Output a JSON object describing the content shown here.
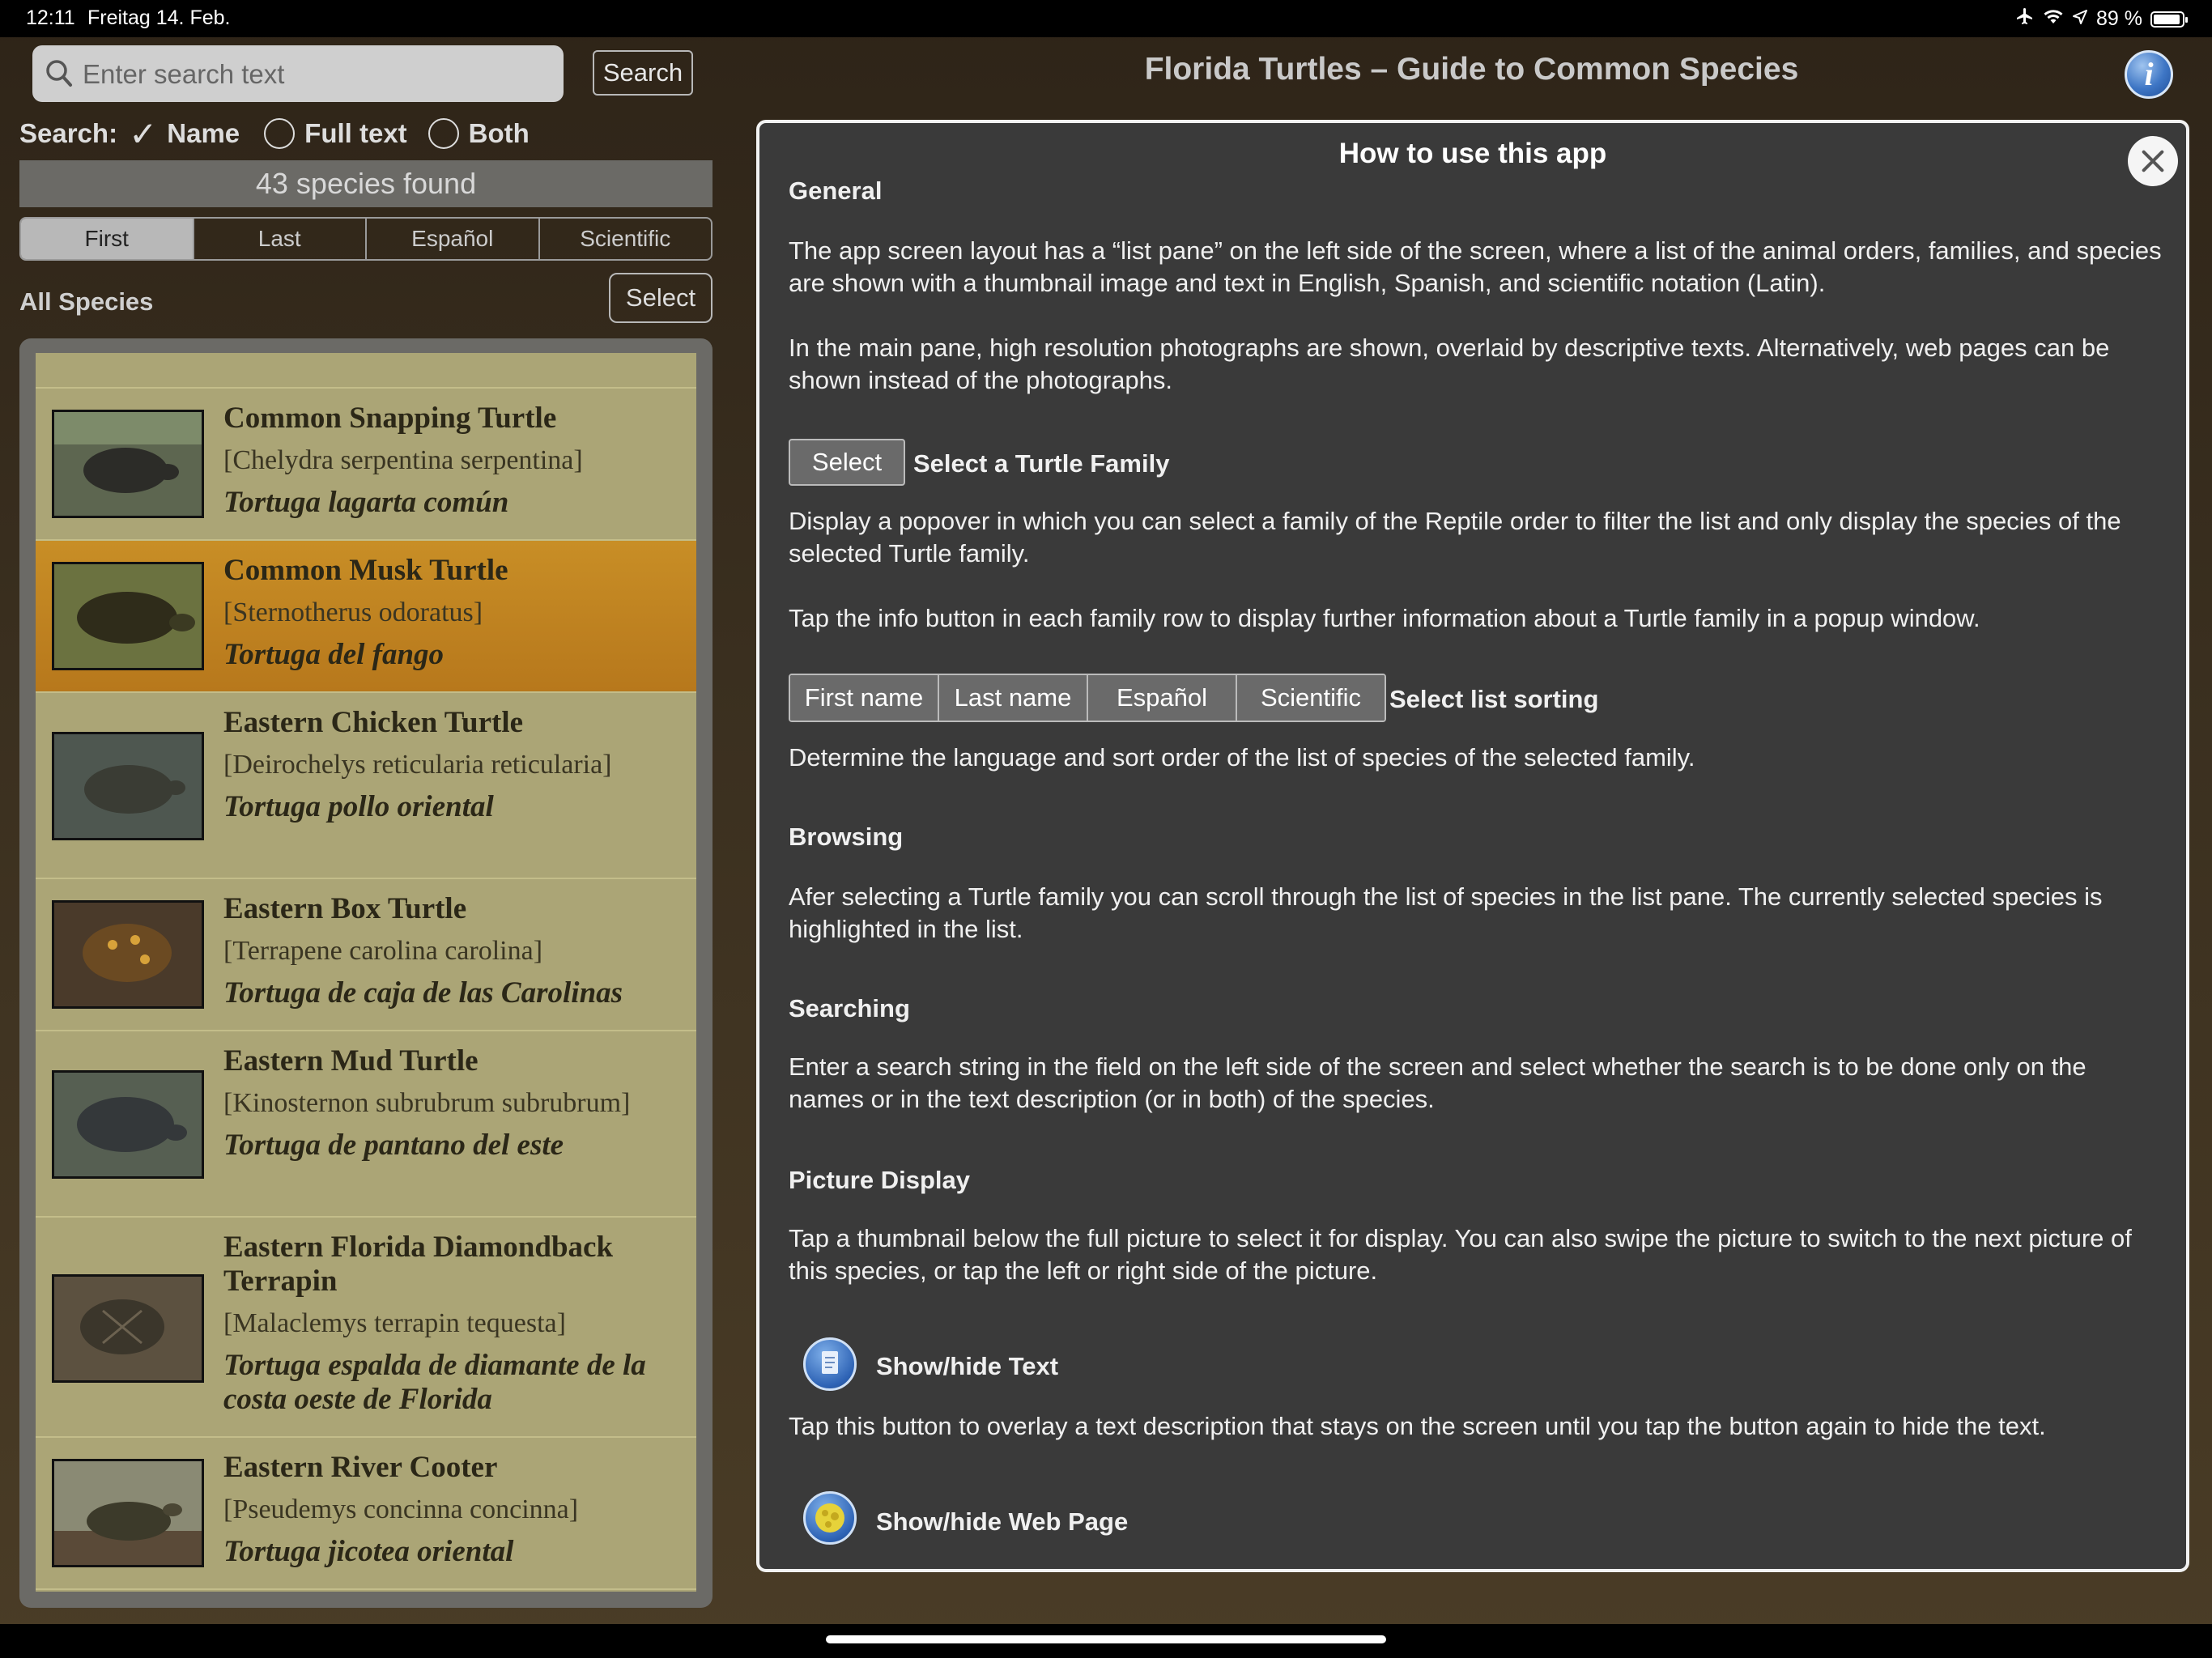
{
  "status_bar": {
    "time": "12:11",
    "date": "Freitag 14. Feb.",
    "battery": "89 %"
  },
  "search": {
    "placeholder": "Enter search text",
    "button_label": "Search",
    "options_label": "Search:",
    "options": [
      {
        "label": "Name",
        "selected": true
      },
      {
        "label": "Full text",
        "selected": false
      },
      {
        "label": "Both",
        "selected": false
      }
    ]
  },
  "result_count": "43 species found",
  "sort_tabs": [
    {
      "label": "First",
      "active": true
    },
    {
      "label": "Last",
      "active": false
    },
    {
      "label": "Español",
      "active": false
    },
    {
      "label": "Scientific",
      "active": false
    }
  ],
  "list": {
    "title": "All Species",
    "select_label": "Select",
    "species": [
      {
        "name": "Common Snapping Turtle",
        "scientific": "[Chelydra serpentina serpentina]",
        "spanish": "Tortuga lagarta común",
        "selected": false
      },
      {
        "name": "Common Musk Turtle",
        "scientific": "[Sternotherus odoratus]",
        "spanish": "Tortuga del fango",
        "selected": true
      },
      {
        "name": "Eastern Chicken Turtle",
        "scientific": "[Deirochelys reticularia reticularia]",
        "spanish": "Tortuga pollo oriental",
        "selected": false
      },
      {
        "name": "Eastern Box Turtle",
        "scientific": "[Terrapene carolina carolina]",
        "spanish": "Tortuga de caja de las Carolinas",
        "selected": false
      },
      {
        "name": "Eastern Mud Turtle",
        "scientific": "[Kinosternon subrubrum subrubrum]",
        "spanish": "Tortuga de pantano del este",
        "selected": false
      },
      {
        "name": "Eastern Florida Diamondback Terrapin",
        "scientific": "[Malaclemys terrapin tequesta]",
        "spanish": "Tortuga espalda de diamante de la costa oeste de Florida",
        "selected": false
      },
      {
        "name": "Eastern River Cooter",
        "scientific": "[Pseudemys concinna concinna]",
        "spanish": "Tortuga jicotea oriental",
        "selected": false
      }
    ]
  },
  "header": {
    "title": "Florida Turtles – Guide to Common Species"
  },
  "help": {
    "title": "How to use this app",
    "general_heading": "General",
    "general_p1": "The app screen layout has a “list pane” on the left side of the screen, where a list of the animal orders, families, and species are shown with a thumbnail image and text in English, Spanish, and scientific notation (Latin).",
    "general_p2": "In the main pane, high resolution photographs are shown, overlaid by descriptive texts. Alternatively, web pages can be shown instead of the photographs.",
    "select_demo_label": "Select",
    "select_heading": "Select a Turtle Family",
    "select_p1": "Display a popover in which you can select a family of the Reptile order to filter the list and only display the species of the selected Turtle family.",
    "select_p2": "Tap the info button in each family row to display further information about a Turtle family in a popup window.",
    "sorting_demo": [
      "First name",
      "Last name",
      "Español",
      "Scientific"
    ],
    "sorting_heading": "Select list sorting",
    "sorting_p": "Determine the language and sort order of the list of species of the selected family.",
    "browsing_heading": "Browsing",
    "browsing_p": "Afer selecting a Turtle family you can scroll through the list of species in the list pane. The currently selected species is highlighted in the list.",
    "searching_heading": "Searching",
    "searching_p": "Enter a search string in the field on the left side of the screen and select whether the search is to be done only on the names or in the text description (or in both) of the species.",
    "picture_heading": "Picture Display",
    "picture_p": "Tap a thumbnail below the full picture to select it for display. You can also swipe the picture to switch to the next picture of this species, or tap the left or right side of the picture.",
    "text_heading": "Show/hide Text",
    "text_p": "Tap this button to overlay a text description that stays on the screen until you tap the button again to hide the text.",
    "web_heading": "Show/hide Web Page"
  },
  "icons": {
    "status": [
      "airplane-icon",
      "wifi-icon",
      "location-icon",
      "battery-icon"
    ],
    "search": "search-icon",
    "info": "info-icon",
    "close": "close-icon",
    "text_toggle": "text-document-icon",
    "web_toggle": "web-page-icon"
  },
  "colors": {
    "list_background": "#aba576",
    "selected_row": "#c08420",
    "panel_background": "#3a3a3a",
    "info_blue": "#3e76c5"
  }
}
